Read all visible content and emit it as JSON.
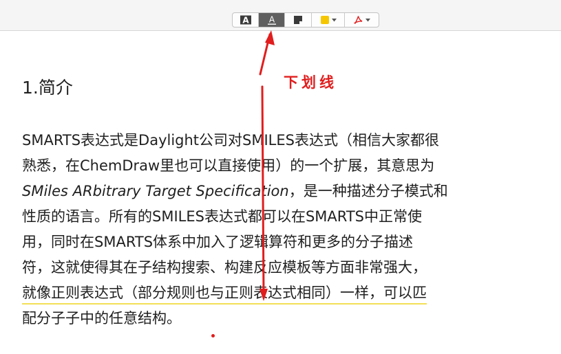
{
  "colors": {
    "annotation_red": "#e11d1d",
    "underline_yellow": "#f2df55",
    "swatch_yellow": "#f6c700",
    "pdf_red": "#e11d1d",
    "toolbar_bg": "#f5f5f5",
    "text": "#1f1f1f"
  },
  "toolbar": {
    "buttons": [
      {
        "icon": "text-highlight-icon",
        "glyph": "A",
        "active": false
      },
      {
        "icon": "text-underline-icon",
        "glyph": "A",
        "active": true
      },
      {
        "icon": "note-icon",
        "active": false
      },
      {
        "icon": "color-swatch-icon",
        "active": false
      },
      {
        "icon": "pdf-sign-icon",
        "active": false
      }
    ]
  },
  "document": {
    "heading": "1.简介",
    "lines": [
      "SMARTS表达式是Daylight公司对SMILES表达式（相信大家都很",
      "熟悉，在ChemDraw里也可以直接使用）的一个扩展，其意思为",
      {
        "italic": "SMiles ARbitrary Target Specification",
        "rest": "，是一种描述分子模式和"
      },
      "性质的语言。所有的SMILES表达式都可以在SMARTS中正常使",
      "用，同时在SMARTS体系中加入了逻辑算符和更多的分子描述",
      "符，这就使得其在子结构搜索、构建反应模板等方面非常强大，",
      "就像正则表达式（部分规则也与正则表达式相同）一样，可以匹",
      "配分子子中的任意结构。"
    ]
  },
  "annotation": {
    "label": "下划线"
  }
}
